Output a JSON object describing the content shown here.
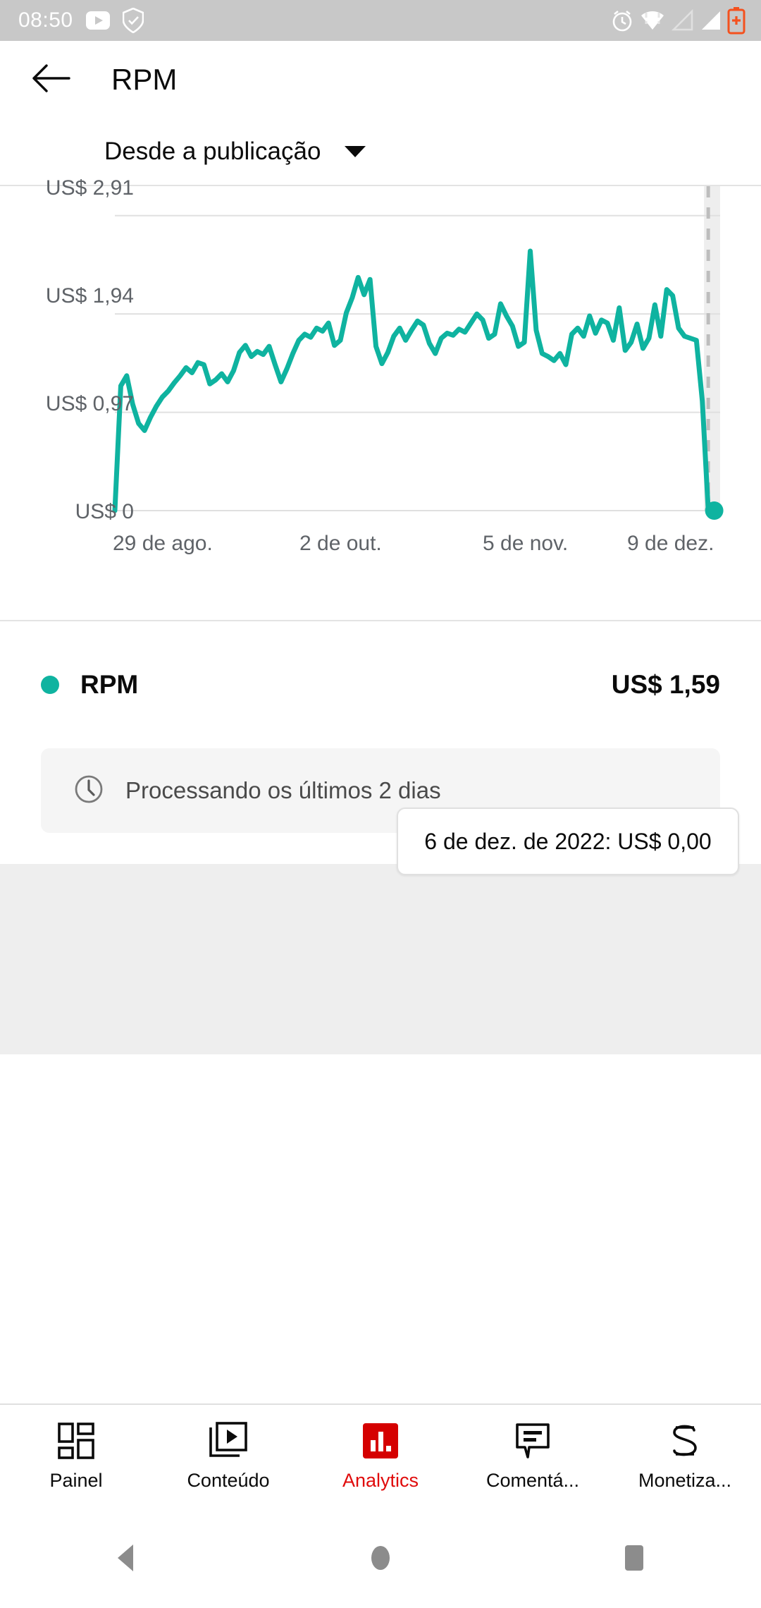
{
  "status_bar": {
    "time": "08:50",
    "left_icons": [
      "youtube-icon",
      "shield-check-icon"
    ],
    "right_icons": [
      "alarm-icon",
      "wifi-icon",
      "signal-empty-icon",
      "signal-icon",
      "battery-charging-icon"
    ],
    "background": "#c8c8c8"
  },
  "app_bar": {
    "back_icon": "arrow-left-icon",
    "title": "RPM"
  },
  "period": {
    "label": "Desde a publicação",
    "caret_icon": "chevron-down-icon"
  },
  "chart_data": {
    "type": "line",
    "title": "RPM",
    "xlabel": "",
    "ylabel": "",
    "ylim": [
      0,
      3.2
    ],
    "grid": true,
    "legend_position": "below",
    "line_color": "#0FB3A0",
    "y_ticks": [
      {
        "value": 2.91,
        "label": "US$ 2,91"
      },
      {
        "value": 1.94,
        "label": "US$ 1,94"
      },
      {
        "value": 0.97,
        "label": "US$ 0,97"
      },
      {
        "value": 0,
        "label": "US$ 0"
      }
    ],
    "x_ticks": [
      {
        "label": "29 de ago.",
        "index": 0
      },
      {
        "label": "2 de out.",
        "index": 34
      },
      {
        "label": "5 de nov.",
        "index": 68
      },
      {
        "label": "9 de dez.",
        "index": 102
      }
    ],
    "series": [
      {
        "name": "RPM",
        "color": "#0FB3A0",
        "values": [
          0.0,
          1.23,
          1.33,
          1.05,
          0.86,
          0.79,
          0.92,
          1.03,
          1.12,
          1.18,
          1.26,
          1.33,
          1.41,
          1.36,
          1.46,
          1.44,
          1.25,
          1.29,
          1.35,
          1.27,
          1.38,
          1.56,
          1.63,
          1.52,
          1.57,
          1.54,
          1.62,
          1.44,
          1.27,
          1.4,
          1.55,
          1.68,
          1.74,
          1.71,
          1.8,
          1.77,
          1.85,
          1.63,
          1.68,
          1.95,
          2.1,
          2.3,
          2.13,
          2.28,
          1.62,
          1.45,
          1.56,
          1.72,
          1.8,
          1.68,
          1.78,
          1.87,
          1.83,
          1.65,
          1.55,
          1.7,
          1.75,
          1.73,
          1.79,
          1.76,
          1.85,
          1.94,
          1.88,
          1.7,
          1.74,
          2.04,
          1.92,
          1.82,
          1.62,
          1.66,
          2.56,
          1.78,
          1.55,
          1.52,
          1.48,
          1.55,
          1.44,
          1.74,
          1.8,
          1.72,
          1.92,
          1.75,
          1.88,
          1.85,
          1.68,
          2.0,
          1.58,
          1.66,
          1.84,
          1.6,
          1.7,
          2.03,
          1.72,
          2.18,
          2.12,
          1.8,
          1.72,
          1.7,
          1.68,
          1.08,
          0.0,
          0.0,
          0.0
        ]
      }
    ],
    "highlight": {
      "tooltip": "6 de dez. de 2022: US$ 0,00",
      "marker_index": 101,
      "marker_value": 0.0,
      "shaded_region_note": "processing region shaded at right"
    }
  },
  "legend": {
    "dot_icon": "legend-dot-icon",
    "name": "RPM",
    "value": "US$ 1,59"
  },
  "notice": {
    "icon": "clock-icon",
    "text": "Processando os últimos 2 dias"
  },
  "bottom_nav": {
    "active_color": "#e00b0b",
    "items": [
      {
        "label": "Painel",
        "icon": "dashboard-grid-icon",
        "active": false
      },
      {
        "label": "Conteúdo",
        "icon": "video-stack-icon",
        "active": false
      },
      {
        "label": "Analytics",
        "icon": "bar-chart-icon",
        "active": true
      },
      {
        "label": "Comentá...",
        "icon": "comment-icon",
        "active": false
      },
      {
        "label": "Monetiza...",
        "icon": "dollar-icon",
        "active": false
      }
    ]
  },
  "android_nav": {
    "buttons": [
      {
        "icon": "nav-back-triangle-icon"
      },
      {
        "icon": "nav-home-circle-icon"
      },
      {
        "icon": "nav-recents-square-icon"
      }
    ]
  }
}
